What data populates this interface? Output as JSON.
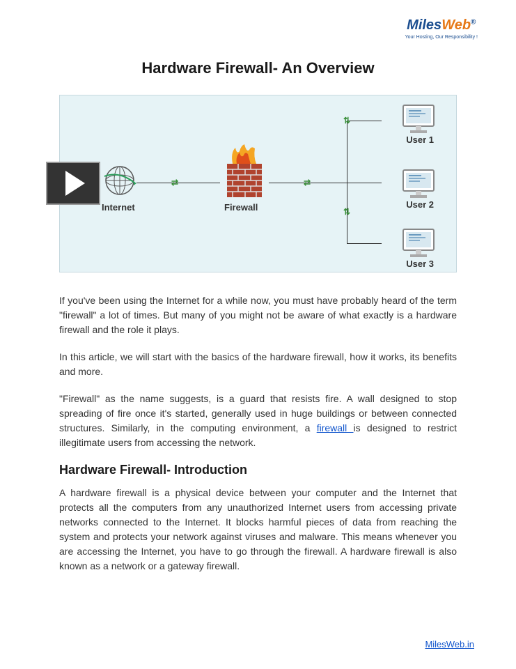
{
  "logo": {
    "part1": "Miles",
    "part2": "Web",
    "reg": "®",
    "tagline": "Your Hosting, Our Responsibility !"
  },
  "title": "Hardware Firewall- An Overview",
  "diagram": {
    "internet": "Internet",
    "firewall": "Firewall",
    "user1": "User 1",
    "user2": "User 2",
    "user3": "User 3"
  },
  "paragraphs": {
    "p1": "If you've been using the Internet for a while now, you must have probably heard of the term \"firewall\" a lot of times. But many of you might not be aware of what exactly is a hardware firewall and the role it plays.",
    "p2": "In this article, we will start with the basics of the hardware firewall, how it works, its benefits and more.",
    "p3a": "\"Firewall\" as the name suggests, is a guard that resists fire. A wall designed to stop spreading of fire once it's started, generally used in huge buildings or between connected structures. Similarly, in the computing environment, a ",
    "p3link": "firewall ",
    "p3b": "is designed to restrict illegitimate users from accessing the network.",
    "p4": "A hardware firewall is a physical device between your computer and the Internet that protects all the computers from any unauthorized Internet users from accessing private networks connected to the Internet. It blocks harmful pieces of data from reaching the system and protects your network against viruses and malware. This means whenever you are accessing the Internet, you have to go through the firewall. A hardware firewall is also known as a network or a gateway firewall."
  },
  "section_heading": "Hardware Firewall- Introduction",
  "footer_link": "MilesWeb.in"
}
